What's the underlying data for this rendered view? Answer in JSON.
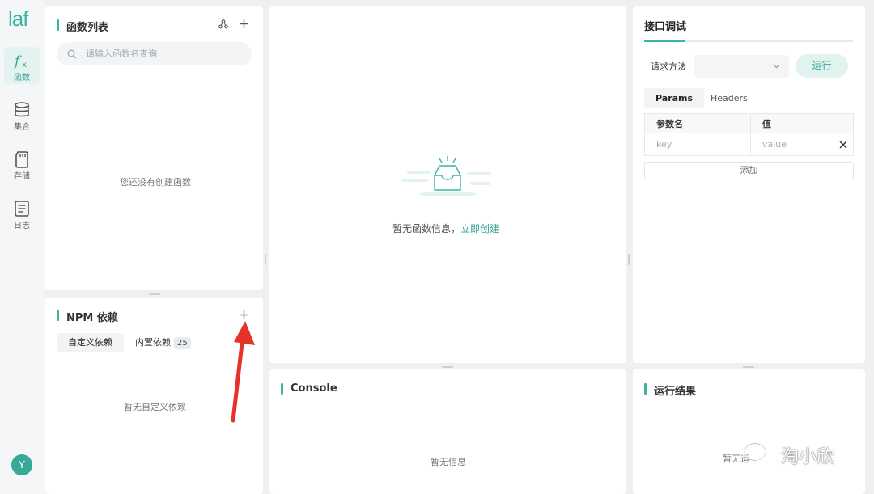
{
  "app": {
    "logo": "laf",
    "avatar": "Y"
  },
  "nav": [
    {
      "label": "函数",
      "icon": "function-icon"
    },
    {
      "label": "集合",
      "icon": "database-icon"
    },
    {
      "label": "存储",
      "icon": "storage-icon"
    },
    {
      "label": "日志",
      "icon": "log-icon"
    }
  ],
  "functions_panel": {
    "title": "函数列表",
    "search_placeholder": "请输入函数名查询",
    "empty_text": "您还没有创建函数"
  },
  "npm_panel": {
    "title": "NPM 依赖",
    "tabs": [
      "自定义依赖",
      "内置依赖"
    ],
    "builtin_count": "25",
    "empty_text": "暂无自定义依赖"
  },
  "editor": {
    "empty_text": "暂无函数信息，",
    "create_link": "立即创建"
  },
  "debug_panel": {
    "tab": "接口调试",
    "method_label": "请求方法",
    "run_button": "运行",
    "tabs": [
      "Params",
      "Headers"
    ],
    "table": {
      "headers": [
        "参数名",
        "值"
      ],
      "key_placeholder": "key",
      "value_placeholder": "value"
    },
    "add_button": "添加"
  },
  "console_panel": {
    "title": "Console",
    "empty_text": "暂无信息"
  },
  "result_panel": {
    "title": "运行结果",
    "empty_text": "暂无运"
  },
  "watermark": "淘小欣",
  "colors": {
    "accent": "#3cb3a3",
    "annotation_arrow": "#e5332a"
  }
}
